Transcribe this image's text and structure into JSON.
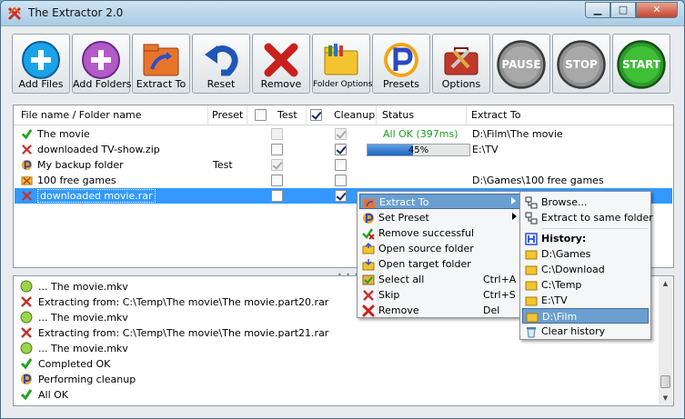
{
  "window": {
    "title": "The Extractor 2.0",
    "minimize": "▁",
    "maximize": "□",
    "close": "✕"
  },
  "toolbar": [
    {
      "label": "Add Files",
      "icon": "add-files-icon"
    },
    {
      "label": "Add Folders",
      "icon": "add-folders-icon"
    },
    {
      "label": "Extract To",
      "icon": "extract-to-icon"
    },
    {
      "label": "Reset",
      "icon": "reset-icon"
    },
    {
      "label": "Remove",
      "icon": "remove-icon"
    },
    {
      "label": "Folder Options",
      "icon": "folder-options-icon"
    },
    {
      "label": "Presets",
      "icon": "presets-icon"
    },
    {
      "label": "Options",
      "icon": "options-icon"
    },
    {
      "label": "PAUSE",
      "icon": "pause-icon"
    },
    {
      "label": "STOP",
      "icon": "stop-icon"
    },
    {
      "label": "START",
      "icon": "start-icon"
    }
  ],
  "grid": {
    "headers": {
      "name": "File name / Folder name",
      "preset": "Preset",
      "test": "Test",
      "cleanup": "Cleanup",
      "status": "Status",
      "extract_to": "Extract To"
    },
    "header_test_checked": false,
    "header_cleanup_checked": true,
    "rows": [
      {
        "name": "The movie",
        "icon": "check-icon",
        "preset": "",
        "test": false,
        "test_disabled": true,
        "cleanup": true,
        "cleanup_disabled": true,
        "status": "All OK (397ms)",
        "extract_to": "D:\\Film\\The movie"
      },
      {
        "name": "downloaded TV-show.zip",
        "icon": "archive-icon",
        "preset": "",
        "test": false,
        "test_disabled": false,
        "cleanup": true,
        "cleanup_disabled": false,
        "status": "",
        "progress": 45,
        "progress_label": "45%",
        "extract_to": "E:\\TV"
      },
      {
        "name": "My backup folder",
        "icon": "preset-icon",
        "preset": "Test",
        "test": true,
        "test_disabled": true,
        "cleanup": false,
        "cleanup_disabled": false,
        "status": "",
        "extract_to": ""
      },
      {
        "name": "100 free games",
        "icon": "folder-icon",
        "preset": "",
        "test": false,
        "test_disabled": false,
        "cleanup": false,
        "cleanup_disabled": false,
        "status": "",
        "extract_to": "D:\\Games\\100 free games"
      },
      {
        "name": "downloaded movie.rar",
        "icon": "archive-icon",
        "preset": "",
        "test": false,
        "test_disabled": false,
        "cleanup": true,
        "cleanup_disabled": false,
        "status": "",
        "extract_to": "",
        "selected": true
      }
    ]
  },
  "log": [
    {
      "icon": "mkv-icon",
      "text": "... The movie.mkv"
    },
    {
      "icon": "archive-icon",
      "text": "Extracting from: C:\\Temp\\The movie\\The movie.part20.rar"
    },
    {
      "icon": "mkv-icon",
      "text": "... The movie.mkv"
    },
    {
      "icon": "archive-icon",
      "text": "Extracting from: C:\\Temp\\The movie\\The movie.part21.rar"
    },
    {
      "icon": "mkv-icon",
      "text": "... The movie.mkv"
    },
    {
      "icon": "check-icon",
      "text": "Completed OK"
    },
    {
      "icon": "cleanup-icon",
      "text": "Performing cleanup"
    },
    {
      "icon": "check-icon",
      "text": "All OK"
    }
  ],
  "context_menu": {
    "items": [
      {
        "label": "Extract To",
        "shortcut": "",
        "icon": "extract-to-icon",
        "submenu": true,
        "highlighted": true
      },
      {
        "label": "Set Preset",
        "shortcut": "",
        "icon": "presets-icon",
        "submenu": true
      },
      {
        "label": "Remove successful",
        "shortcut": "",
        "icon": "check-x-icon"
      },
      {
        "label": "Open source folder",
        "shortcut": "",
        "icon": "folder-open-icon"
      },
      {
        "label": "Open target folder",
        "shortcut": "",
        "icon": "folder-target-icon"
      },
      {
        "label": "Select all",
        "shortcut": "Ctrl+A",
        "icon": "select-all-icon"
      },
      {
        "label": "Skip",
        "shortcut": "Ctrl+S",
        "icon": "skip-icon"
      },
      {
        "label": "Remove",
        "shortcut": "Del",
        "icon": "remove-icon"
      }
    ]
  },
  "submenu": {
    "browse": "Browse...",
    "same_folder": "Extract to same folder",
    "history_label": "History:",
    "history": [
      "D:\\Games",
      "C:\\Download",
      "C:\\Temp",
      "E:\\TV",
      "D:\\Film"
    ],
    "history_selected": "D:\\Film",
    "clear": "Clear history"
  },
  "colors": {
    "selection": "#3399ff",
    "status_ok": "#1e9e1e",
    "menu_highlight": "#6a9fcf"
  }
}
